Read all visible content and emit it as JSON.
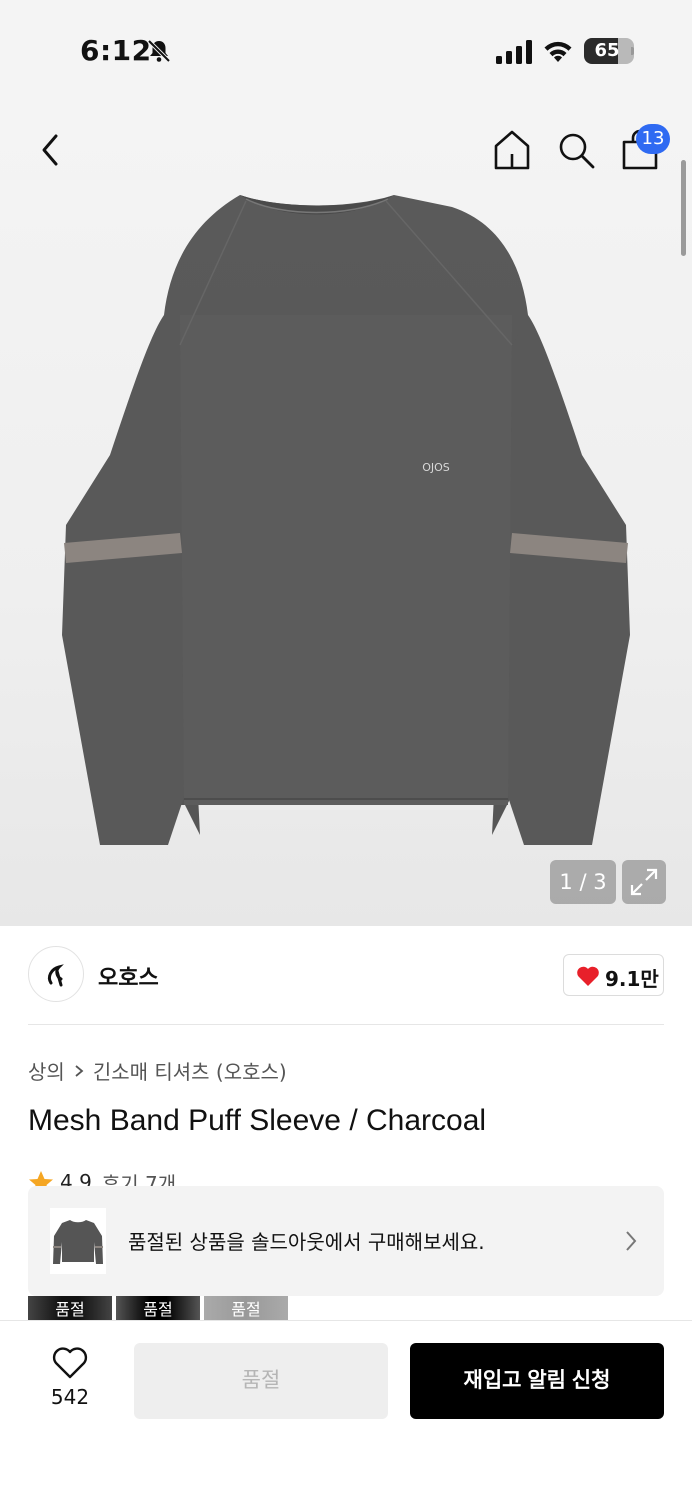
{
  "status_bar": {
    "time": "6:12",
    "battery_level": "65",
    "battery_fraction": 0.65
  },
  "header": {
    "cart_badge": "13"
  },
  "gallery": {
    "counter": "1 / 3",
    "current": 1,
    "total": 3,
    "garment_logo_text": "OJOS"
  },
  "brand": {
    "name": "오호스",
    "likes": "9.1만"
  },
  "breadcrumb": {
    "category": "상의",
    "subcategory": "긴소매 티셔츠 (오호스)"
  },
  "product": {
    "title": "Mesh Band Puff Sleeve / Charcoal",
    "rating": "4.9",
    "reviews": "후기 7개"
  },
  "notice": {
    "text": "품절된 상품을 솔드아웃에서 구매해보세요."
  },
  "variants": [
    {
      "label": "품절"
    },
    {
      "label": "품절"
    },
    {
      "label": "품절"
    }
  ],
  "bottom_bar": {
    "wish_count": "542",
    "soldout_label": "품절",
    "restock_label": "재입고 알림 신청"
  },
  "colors": {
    "accent_blue": "#2f6af2",
    "heart_red": "#e8202a",
    "primary_black": "#000000",
    "star": "#f5a623"
  }
}
